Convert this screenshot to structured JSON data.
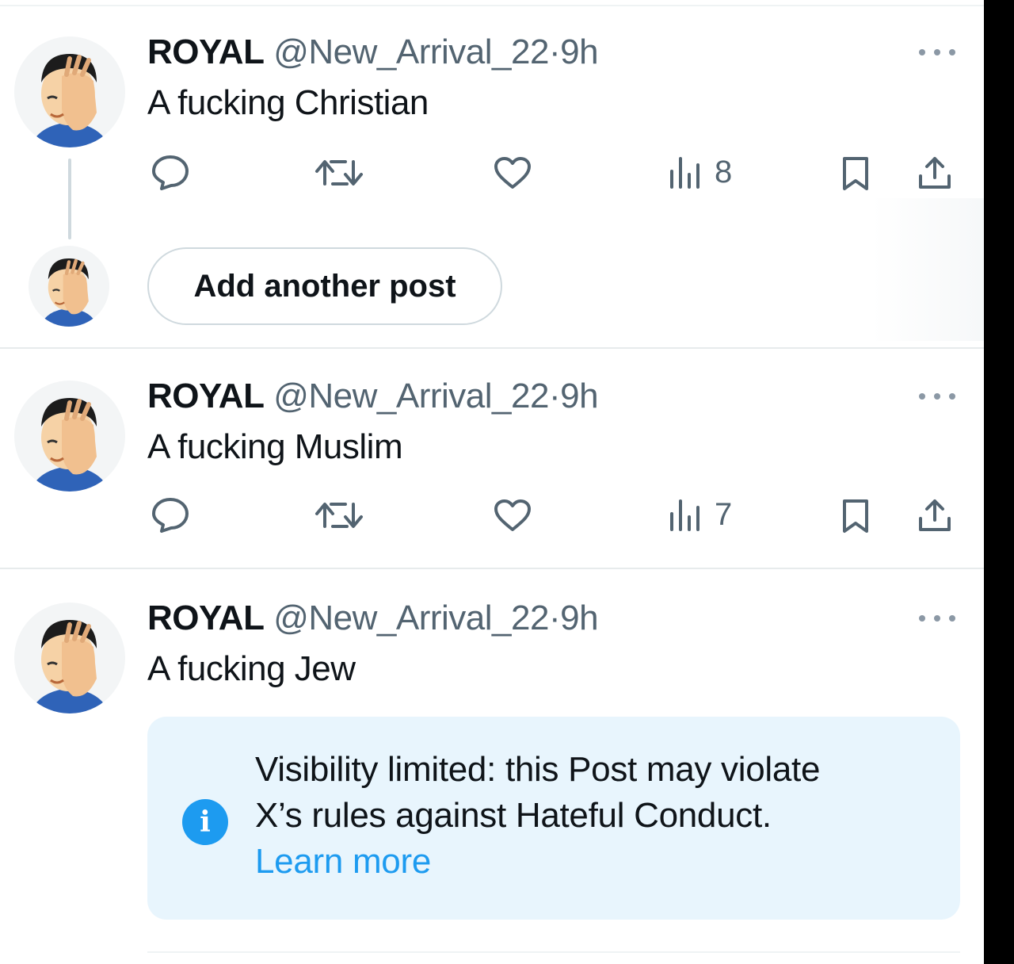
{
  "colors": {
    "text_primary": "#0f1419",
    "text_secondary": "#536471",
    "accent": "#1d9bf0",
    "notice_bg": "#e8f5fd",
    "divider": "#e7ebec"
  },
  "posts": [
    {
      "author_name": "ROYAL",
      "handle": "@New_Arrival_22",
      "separator": "·",
      "time": "9h",
      "text": "A fucking Christian",
      "views": "8",
      "icons": [
        "reply-icon",
        "repost-icon",
        "like-icon",
        "views-icon",
        "bookmark-icon",
        "share-icon"
      ]
    },
    {
      "author_name": "ROYAL",
      "handle": "@New_Arrival_22",
      "separator": "·",
      "time": "9h",
      "text": "A fucking Muslim",
      "views": "7",
      "icons": [
        "reply-icon",
        "repost-icon",
        "like-icon",
        "views-icon",
        "bookmark-icon",
        "share-icon"
      ]
    },
    {
      "author_name": "ROYAL",
      "handle": "@New_Arrival_22",
      "separator": "·",
      "time": "9h",
      "text": "A fucking Jew"
    }
  ],
  "composer": {
    "add_post_label": "Add another post"
  },
  "notice": {
    "icon": "info-icon",
    "icon_glyph": "i",
    "line1": "Visibility limited: this Post may violate",
    "line2": "X’s rules against Hateful Conduct.",
    "link": "Learn more"
  }
}
